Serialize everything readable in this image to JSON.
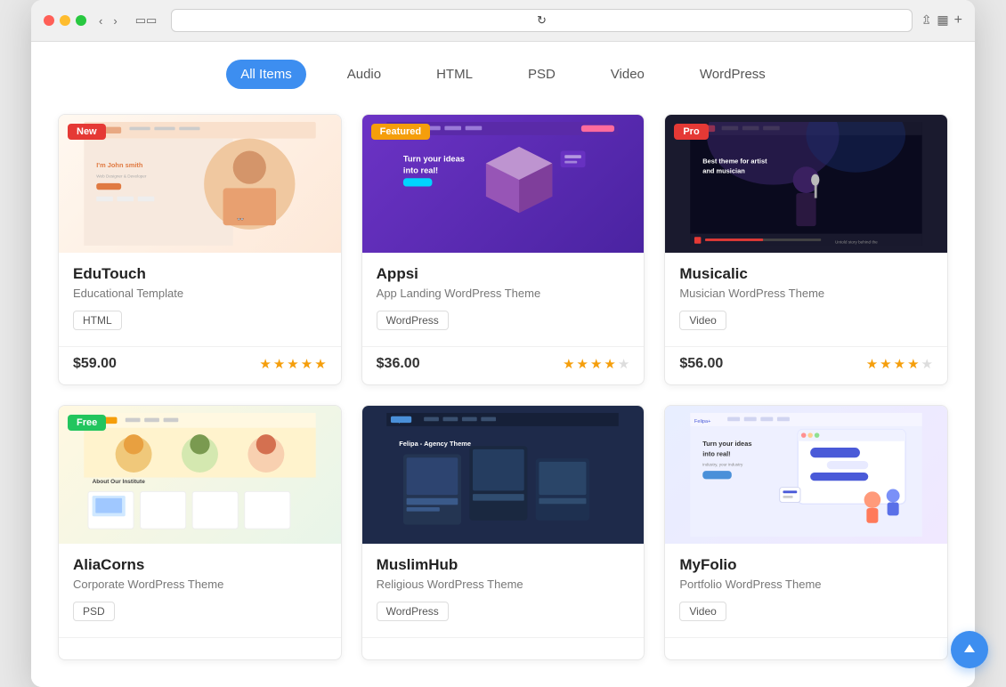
{
  "browser": {
    "address": ""
  },
  "filter": {
    "active": "All Items",
    "items": [
      "All Items",
      "Audio",
      "HTML",
      "PSD",
      "Video",
      "WordPress"
    ]
  },
  "items": [
    {
      "id": "edutouch",
      "badge": "New",
      "badge_type": "new",
      "title": "EduTouch",
      "subtitle": "Educational Template",
      "tag": "HTML",
      "price": "$59.00",
      "rating": 5,
      "max_rating": 5,
      "thumb_type": "edutouch"
    },
    {
      "id": "appsi",
      "badge": "Featured",
      "badge_type": "featured",
      "title": "Appsi",
      "subtitle": "App Landing WordPress Theme",
      "tag": "WordPress",
      "price": "$36.00",
      "rating": 4,
      "max_rating": 5,
      "thumb_type": "appsi"
    },
    {
      "id": "musicalic",
      "badge": "Pro",
      "badge_type": "pro",
      "title": "Musicalic",
      "subtitle": "Musician WordPress Theme",
      "tag": "Video",
      "price": "$56.00",
      "rating": 4,
      "max_rating": 5,
      "thumb_type": "musicalic"
    },
    {
      "id": "aliacorns",
      "badge": "Free",
      "badge_type": "free",
      "title": "AliaCorns",
      "subtitle": "Corporate WordPress Theme",
      "tag": "PSD",
      "price": null,
      "rating": 0,
      "max_rating": 5,
      "thumb_type": "aliacorns"
    },
    {
      "id": "muslimhub",
      "badge": null,
      "badge_type": null,
      "title": "MuslimHub",
      "subtitle": "Religious WordPress Theme",
      "tag": "WordPress",
      "price": null,
      "rating": 0,
      "max_rating": 5,
      "thumb_type": "muslimhub"
    },
    {
      "id": "myfolio",
      "badge": null,
      "badge_type": null,
      "title": "MyFolio",
      "subtitle": "Portfolio WordPress Theme",
      "tag": "Video",
      "price": null,
      "rating": 0,
      "max_rating": 5,
      "thumb_type": "myfolio"
    }
  ]
}
